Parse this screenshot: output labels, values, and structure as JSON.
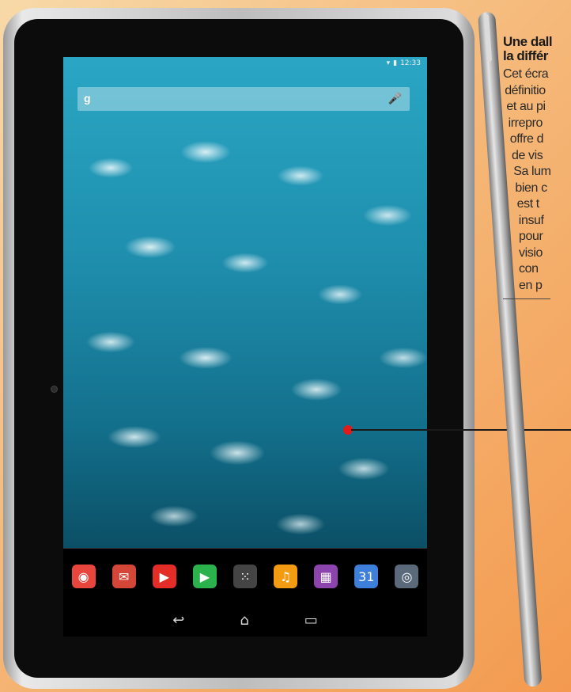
{
  "article": {
    "heading": [
      "Une dall",
      "la différ"
    ],
    "body": [
      "Cet écra",
      "définitio",
      "et au pi",
      "irrepro",
      "offre d",
      "de vis",
      "Sa lum",
      "bien c",
      "est t",
      "insuf",
      "pour",
      "visio",
      "con",
      "en p"
    ]
  },
  "tablet": {
    "status_bar": {
      "time": "12:33",
      "indicators": [
        "wifi-icon",
        "battery-icon"
      ]
    },
    "dock_apps": [
      {
        "name": "chrome",
        "icon": "chrome-icon",
        "glyph": "◉",
        "color": "#e8453c"
      },
      {
        "name": "gmail",
        "icon": "gmail-icon",
        "glyph": "✉",
        "color": "#d44638"
      },
      {
        "name": "youtube",
        "icon": "youtube-icon",
        "glyph": "▶",
        "color": "#e52d27"
      },
      {
        "name": "play-store",
        "icon": "play-store-icon",
        "glyph": "▶",
        "color": "#2bb24c"
      },
      {
        "name": "app-drawer",
        "icon": "app-drawer-icon",
        "glyph": "⁙",
        "color": "#444444"
      },
      {
        "name": "play-music",
        "icon": "play-music-icon",
        "glyph": "♫",
        "color": "#f39c12"
      },
      {
        "name": "gallery",
        "icon": "gallery-icon",
        "glyph": "▦",
        "color": "#8e44ad"
      },
      {
        "name": "calendar",
        "icon": "calendar-icon",
        "glyph": "31",
        "color": "#3d7fd9"
      },
      {
        "name": "camera",
        "icon": "camera-icon",
        "glyph": "◎",
        "color": "#5a6a7a"
      }
    ],
    "nav_buttons": [
      {
        "name": "back",
        "icon": "back-icon",
        "glyph": "↩"
      },
      {
        "name": "home",
        "icon": "home-icon",
        "glyph": "⌂"
      },
      {
        "name": "recents",
        "icon": "recents-icon",
        "glyph": "▭"
      }
    ],
    "colors": {
      "marker": "#e11a1a",
      "background": "#f5b97a"
    }
  }
}
